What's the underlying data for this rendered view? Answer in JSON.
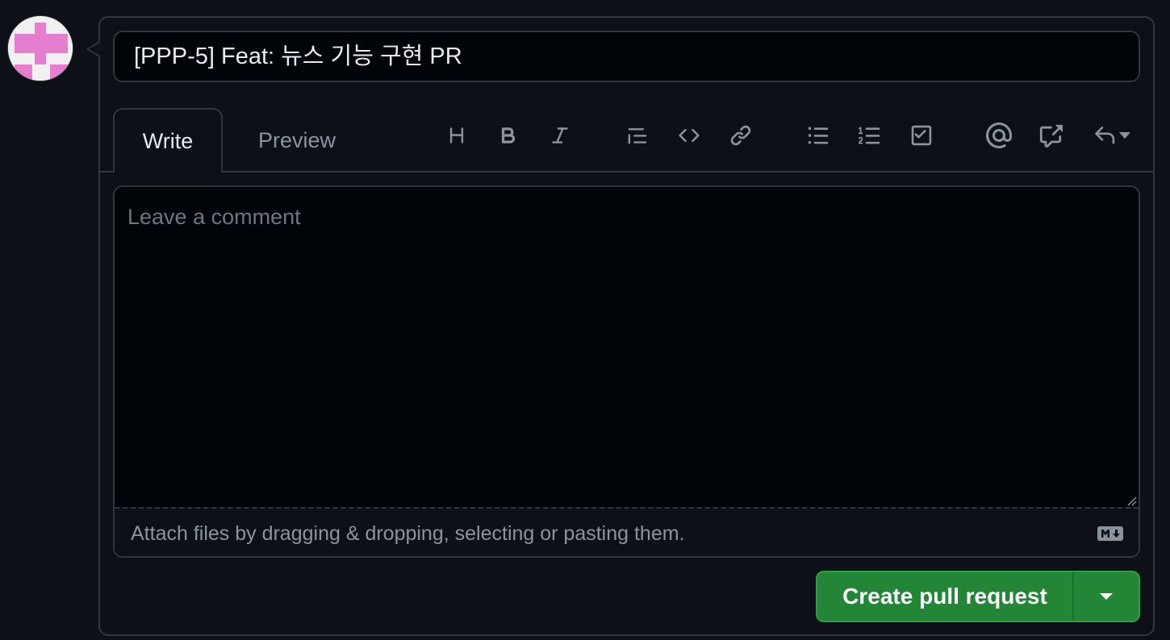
{
  "colors": {
    "background": "#0d1117",
    "input_bg": "#010409",
    "border": "#30363d",
    "text_primary": "#e6edf3",
    "text_muted": "#8b949e",
    "placeholder": "#6e7681",
    "button_green": "#238636",
    "avatar_pink": "#e67ed0"
  },
  "title_input": {
    "value": "[PPP-5] Feat: 뉴스 기능 구현 PR"
  },
  "tabs": [
    {
      "label": "Write",
      "active": true
    },
    {
      "label": "Preview",
      "active": false
    }
  ],
  "toolbar": [
    {
      "icon": "heading-icon",
      "tooltip": "Heading"
    },
    {
      "icon": "bold-icon",
      "tooltip": "Bold"
    },
    {
      "icon": "italic-icon",
      "tooltip": "Italic"
    },
    {
      "icon": "quote-icon",
      "tooltip": "Quote"
    },
    {
      "icon": "code-icon",
      "tooltip": "Code"
    },
    {
      "icon": "link-icon",
      "tooltip": "Link"
    },
    {
      "icon": "unordered-list-icon",
      "tooltip": "Unordered list"
    },
    {
      "icon": "ordered-list-icon",
      "tooltip": "Numbered list"
    },
    {
      "icon": "task-list-icon",
      "tooltip": "Task list"
    },
    {
      "icon": "mention-icon",
      "tooltip": "Mention"
    },
    {
      "icon": "cross-reference-icon",
      "tooltip": "Reference"
    },
    {
      "icon": "reply-icon",
      "tooltip": "Saved replies"
    }
  ],
  "editor": {
    "placeholder": "Leave a comment",
    "attach_hint": "Attach files by dragging & dropping, selecting or pasting them."
  },
  "submit": {
    "label": "Create pull request"
  }
}
